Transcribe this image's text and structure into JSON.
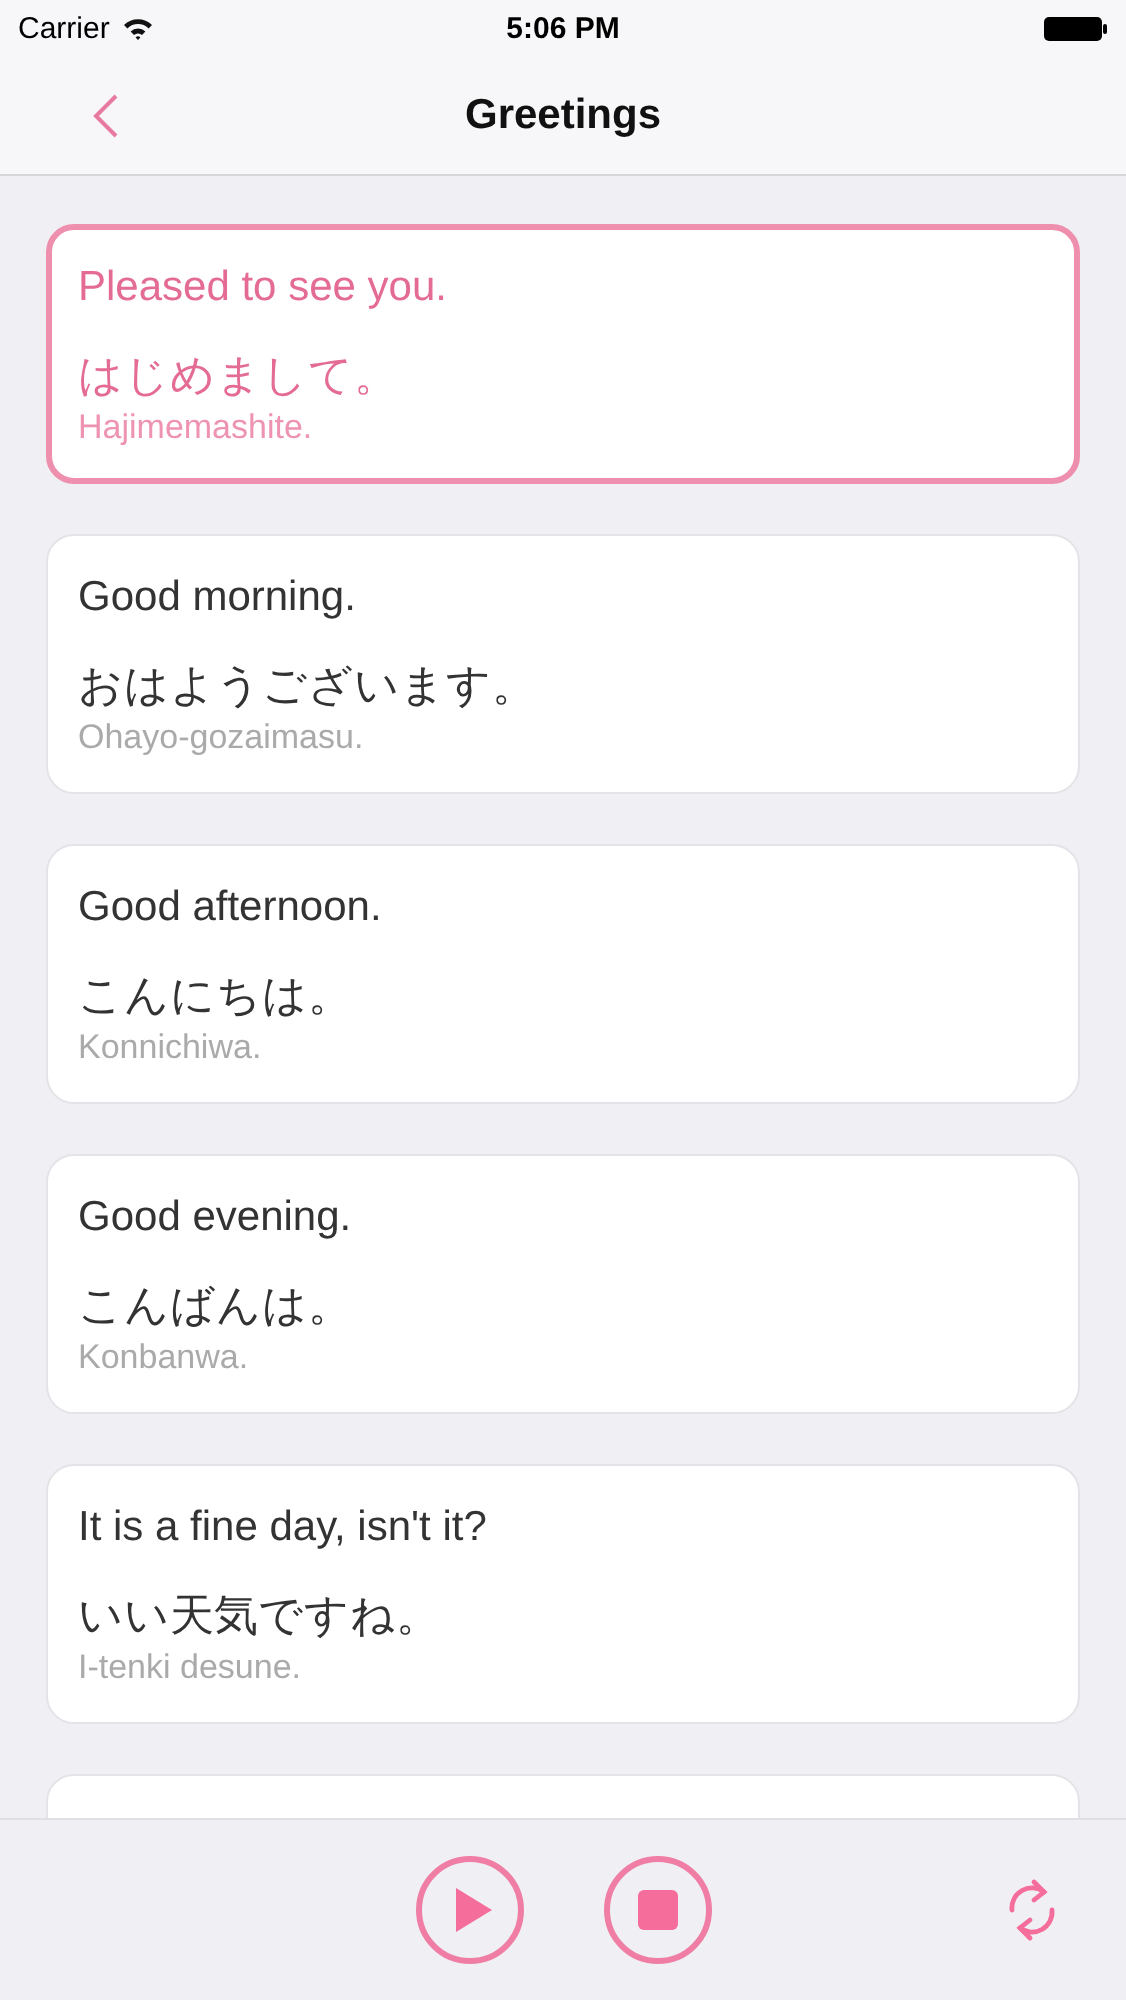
{
  "status_bar": {
    "carrier": "Carrier",
    "time": "5:06 PM"
  },
  "nav": {
    "title": "Greetings"
  },
  "phrases": [
    {
      "kind": "phrase",
      "english": "Pleased to see you.",
      "japanese": "はじめまして。",
      "romaji": "Hajimemashite.",
      "selected": true
    },
    {
      "kind": "phrase",
      "english": "Good morning.",
      "japanese": "おはようございます。",
      "romaji": "Ohayo-gozaimasu.",
      "selected": false
    },
    {
      "kind": "phrase",
      "english": "Good afternoon.",
      "japanese": "こんにちは。",
      "romaji": "Konnichiwa.",
      "selected": false
    },
    {
      "kind": "phrase",
      "english": "Good evening.",
      "japanese": "こんばんは。",
      "romaji": "Konbanwa.",
      "selected": false
    },
    {
      "kind": "phrase",
      "english": "It is a fine day, isn't it?",
      "japanese": "いい天気ですね。",
      "romaji": "I-tenki desune.",
      "selected": false
    },
    {
      "kind": "partial",
      "selected": false
    }
  ]
}
